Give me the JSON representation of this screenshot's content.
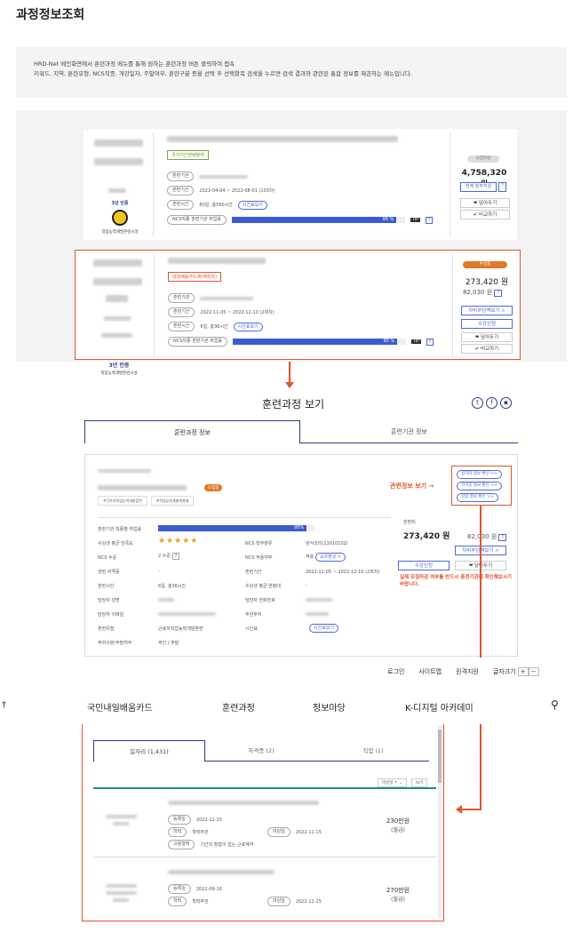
{
  "page": {
    "title": "과정정보조회"
  },
  "info": {
    "line1": "HRD-Net 메인화면에서 훈련과정 메뉴를 통해 원하는 훈련과정 버튼 클릭하여 접속",
    "line2": "키워드, 지역, 훈련유형, NCS직종, 개강일자, 주말여부, 훈련구분 등을 선택 후 선택항목 검색을 누르면 검색 결과와 관련된 통합 정보를 제공하는 메뉴입니다."
  },
  "card1": {
    "tag": "국가기간전략분야",
    "labels": [
      "훈련기관",
      "훈련기간",
      "훈련시간",
      "NCS직종 훈련기관 취업률"
    ],
    "period": "2022-04-04 ~ 2022-08-01 (103차)",
    "hours": "80일, 총560시간",
    "schedule_btn": "시간표보기",
    "progress_label": "95 %",
    "progress": 0.95,
    "tip": "TIP",
    "help": "?",
    "badge": "모집마감",
    "price": "4,758,320 원",
    "support_btn": "전액 정부지원",
    "actions": [
      "담아두기",
      "비교하기"
    ],
    "cert": "3년 인증",
    "org": "직업능력개발훈련시설"
  },
  "card2": {
    "tag": "내일배움카드제(재직자)",
    "labels": [
      "훈련기관",
      "훈련기간",
      "훈련시간",
      "NCS직종 훈련기관 취업률"
    ],
    "period": "2022-11-05 ~ 2022-12-10 (2회차)",
    "hours": "6일, 총36시간",
    "schedule_btn": "시간표보기",
    "progress_label": "95 %",
    "progress": 0.95,
    "tip": "TIP",
    "help": "?",
    "badge": "수강중",
    "price": "273,420 원",
    "price2": "82,030 원",
    "support_btn": "자비부담액보기 >",
    "apply_btn": "수강신청",
    "actions": [
      "담아두기",
      "비교하기"
    ],
    "cert": "3년 인증",
    "org": "직업능력개발훈련시설"
  },
  "detail": {
    "title": "훈련과정 보기",
    "tabs": [
      "훈련과정 정보",
      "훈련기관 정보"
    ],
    "badge": "모집중",
    "chips": [
      "#근로자직업능력개발훈련",
      "#직업능력개발계좌제"
    ],
    "link_buttons": [
      "일자리 정보 확인 >>",
      "자격증 정보 확인 >>",
      "직업 정보 확인 >>"
    ],
    "related_label": "관련정보 보기",
    "progress_label": "95%",
    "progress": 0.95,
    "left_rows": [
      [
        "훈련기관 직종별 취업률",
        ""
      ],
      [
        "수강생 평균 만족도",
        "★★★★★"
      ],
      [
        "NCS 수준",
        "2 수준"
      ],
      [
        "관련 자격증",
        "-"
      ],
      [
        "훈련시간",
        "6일, 총36시간"
      ],
      [
        "담당자 성명",
        ""
      ],
      [
        "담당자 이메일",
        ""
      ],
      [
        "훈련유형",
        "근로자직업능력개발훈련"
      ],
      [
        "주야구분/주말여부",
        "주간 / 주말"
      ]
    ],
    "right_rows": [
      [
        "NCS 직무분류",
        "양식조리(13010102)"
      ],
      [
        "NCS 적용여부",
        "적용"
      ],
      [
        "훈련기간",
        "2022-11-05 ~ 2022-12-10 (2회차)"
      ],
      [
        "수강생 평균 연령대",
        "-"
      ],
      [
        "담당자 전화번호",
        ""
      ],
      [
        "주관부처",
        ""
      ],
      [
        "시간표",
        ""
      ]
    ],
    "ncs_btn": "교과편성 >",
    "schedule_btn": "시간표보기",
    "fee_label": "훈련비",
    "price": "273,420 원",
    "price2": "82,030 원",
    "support_btn": "자비부담액보기 >",
    "apply_btn": "수강신청",
    "save_btn": "담아두기",
    "notice": "실제 모집마감 여부를 반드시 훈련기관에 확인해보시기 바랍니다."
  },
  "topnav": {
    "links": [
      "로그인",
      "사이트맵",
      "원격지원",
      "글자크기"
    ],
    "menu": [
      "국민내일배움카드",
      "훈련과정",
      "정보마당",
      "K-디지털 아카데미"
    ]
  },
  "jobs": {
    "tabs": [
      "일자리 (1,431)",
      "자격증 (2)",
      "직업 (1)"
    ],
    "sort": "마감일 ↑",
    "sort_btn": "보기",
    "items": [
      {
        "date1": "2022-11-15",
        "date2": "2022-11-15",
        "wage": "230만원",
        "unit": "(월급)",
        "l1": "등록일",
        "l2": "학력",
        "l3": "학력무관",
        "l4": "마감일",
        "l5": "고용형태",
        "l6": "기간의 정함이 없는 근로계약"
      },
      {
        "date1": "2022-09-16",
        "date2": "2022-11-15",
        "wage": "270만원",
        "unit": "(월급)",
        "l1": "등록일",
        "l2": "학력",
        "l3": "학력무관",
        "l4": "마감일"
      }
    ]
  },
  "colors": {
    "accent": "#e2542a",
    "blue": "#3d5bd1",
    "navy": "#2a3a8c",
    "teal": "#1e8c8c"
  }
}
